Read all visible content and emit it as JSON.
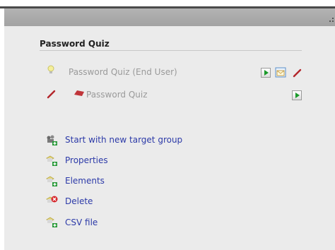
{
  "panel": {
    "section_title": "Password Quiz"
  },
  "quiz_rows": [
    {
      "label": "Password Quiz (End User)"
    },
    {
      "label": "Password Quiz"
    }
  ],
  "actions": [
    {
      "label": "Start with new target group",
      "icon": "target-group-icon"
    },
    {
      "label": "Properties",
      "icon": "properties-icon"
    },
    {
      "label": "Elements",
      "icon": "elements-icon"
    },
    {
      "label": "Delete",
      "icon": "delete-icon"
    },
    {
      "label": "CSV file",
      "icon": "csv-file-icon"
    }
  ],
  "colors": {
    "link": "#2c3aa8",
    "muted_text": "#9a9a9a",
    "play_green": "#1a9a2a",
    "panel_bg": "#ebebeb",
    "header_bg": "#a9a9a9"
  }
}
